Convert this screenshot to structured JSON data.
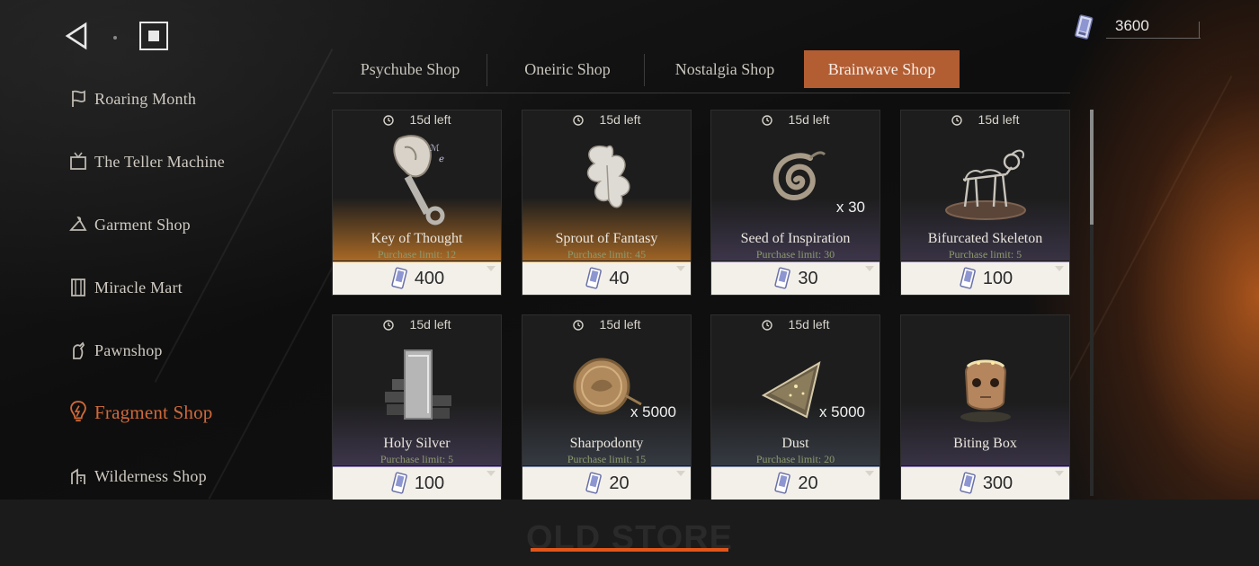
{
  "currency": {
    "value": "3600",
    "icon": "card-ticket-icon"
  },
  "nav": {
    "back_icon": "back-triangle-icon",
    "home_icon": "home-square-icon"
  },
  "sidebar": {
    "items": [
      {
        "label": "Roaring Month",
        "icon": "banner-icon",
        "active": false
      },
      {
        "label": "The Teller Machine",
        "icon": "tv-icon",
        "active": false
      },
      {
        "label": "Garment Shop",
        "icon": "hanger-icon",
        "active": false
      },
      {
        "label": "Miracle Mart",
        "icon": "shelf-icon",
        "active": false
      },
      {
        "label": "Pawnshop",
        "icon": "hand-icon",
        "active": false
      },
      {
        "label": "Fragment Shop",
        "icon": "lightbulb-icon",
        "active": true
      },
      {
        "label": "Wilderness Shop",
        "icon": "building-icon",
        "active": false
      }
    ]
  },
  "tabs": [
    {
      "label": "Psychube Shop",
      "active": false
    },
    {
      "label": "Oneiric Shop",
      "active": false
    },
    {
      "label": "Nostalgia Shop",
      "active": false
    },
    {
      "label": "Brainwave Shop",
      "active": true
    }
  ],
  "items": [
    {
      "name": "Key of Thought",
      "timer": "15d left",
      "limit": "Purchase limit: 12",
      "price": "400",
      "qty": "",
      "icon": "shell-key-icon",
      "rarity": "#e0a030"
    },
    {
      "name": "Sprout of Fantasy",
      "timer": "15d left",
      "limit": "Purchase limit: 45",
      "price": "40",
      "qty": "",
      "icon": "sprout-icon",
      "rarity": "#e0a030"
    },
    {
      "name": "Seed of Inspiration",
      "timer": "15d left",
      "limit": "Purchase limit: 30",
      "price": "30",
      "qty": "x  30",
      "icon": "spiral-seed-icon",
      "rarity": "#8e7bb8"
    },
    {
      "name": "Bifurcated Skeleton",
      "timer": "15d left",
      "limit": "Purchase limit: 5",
      "price": "100",
      "qty": "",
      "icon": "skeleton-icon",
      "rarity": "#8e7bb8"
    },
    {
      "name": "Holy Silver",
      "timer": "15d left",
      "limit": "Purchase limit: 5",
      "price": "100",
      "qty": "",
      "icon": "silver-ingot-icon",
      "rarity": "#8e7bb8"
    },
    {
      "name": "Sharpodonty",
      "timer": "15d left",
      "limit": "Purchase limit: 15",
      "price": "20",
      "qty": "x  5000",
      "icon": "coin-icon",
      "rarity": "#7b8aa8"
    },
    {
      "name": "Dust",
      "timer": "15d left",
      "limit": "Purchase limit: 20",
      "price": "20",
      "qty": "x  5000",
      "icon": "dust-triangle-icon",
      "rarity": "#7b8aa8"
    },
    {
      "name": "Biting Box",
      "timer": "",
      "limit": "",
      "price": "300",
      "qty": "",
      "icon": "biting-box-icon",
      "rarity": "#8e7bb8"
    }
  ],
  "footer": {
    "title": "OLD STORE",
    "accent": "#e2561a"
  },
  "colors": {
    "active_tab": "#b35d33",
    "active_sidebar": "#d0693a"
  }
}
